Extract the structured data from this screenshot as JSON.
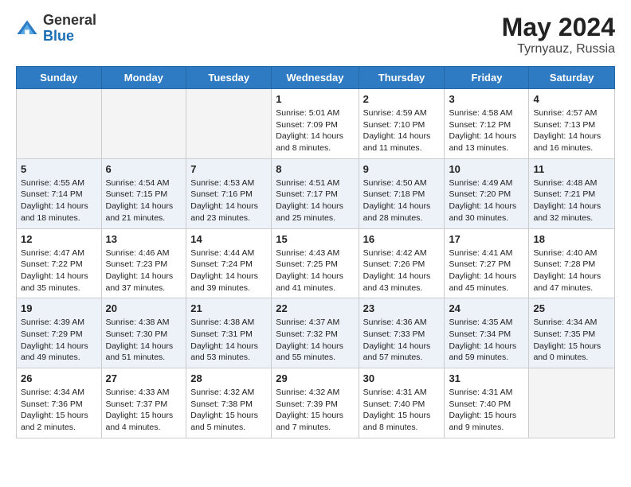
{
  "header": {
    "logo_general": "General",
    "logo_blue": "Blue",
    "title": "May 2024",
    "location": "Tyrnyauz, Russia"
  },
  "weekdays": [
    "Sunday",
    "Monday",
    "Tuesday",
    "Wednesday",
    "Thursday",
    "Friday",
    "Saturday"
  ],
  "weeks": [
    [
      {
        "day": "",
        "info": ""
      },
      {
        "day": "",
        "info": ""
      },
      {
        "day": "",
        "info": ""
      },
      {
        "day": "1",
        "info": "Sunrise: 5:01 AM\nSunset: 7:09 PM\nDaylight: 14 hours\nand 8 minutes."
      },
      {
        "day": "2",
        "info": "Sunrise: 4:59 AM\nSunset: 7:10 PM\nDaylight: 14 hours\nand 11 minutes."
      },
      {
        "day": "3",
        "info": "Sunrise: 4:58 AM\nSunset: 7:12 PM\nDaylight: 14 hours\nand 13 minutes."
      },
      {
        "day": "4",
        "info": "Sunrise: 4:57 AM\nSunset: 7:13 PM\nDaylight: 14 hours\nand 16 minutes."
      }
    ],
    [
      {
        "day": "5",
        "info": "Sunrise: 4:55 AM\nSunset: 7:14 PM\nDaylight: 14 hours\nand 18 minutes."
      },
      {
        "day": "6",
        "info": "Sunrise: 4:54 AM\nSunset: 7:15 PM\nDaylight: 14 hours\nand 21 minutes."
      },
      {
        "day": "7",
        "info": "Sunrise: 4:53 AM\nSunset: 7:16 PM\nDaylight: 14 hours\nand 23 minutes."
      },
      {
        "day": "8",
        "info": "Sunrise: 4:51 AM\nSunset: 7:17 PM\nDaylight: 14 hours\nand 25 minutes."
      },
      {
        "day": "9",
        "info": "Sunrise: 4:50 AM\nSunset: 7:18 PM\nDaylight: 14 hours\nand 28 minutes."
      },
      {
        "day": "10",
        "info": "Sunrise: 4:49 AM\nSunset: 7:20 PM\nDaylight: 14 hours\nand 30 minutes."
      },
      {
        "day": "11",
        "info": "Sunrise: 4:48 AM\nSunset: 7:21 PM\nDaylight: 14 hours\nand 32 minutes."
      }
    ],
    [
      {
        "day": "12",
        "info": "Sunrise: 4:47 AM\nSunset: 7:22 PM\nDaylight: 14 hours\nand 35 minutes."
      },
      {
        "day": "13",
        "info": "Sunrise: 4:46 AM\nSunset: 7:23 PM\nDaylight: 14 hours\nand 37 minutes."
      },
      {
        "day": "14",
        "info": "Sunrise: 4:44 AM\nSunset: 7:24 PM\nDaylight: 14 hours\nand 39 minutes."
      },
      {
        "day": "15",
        "info": "Sunrise: 4:43 AM\nSunset: 7:25 PM\nDaylight: 14 hours\nand 41 minutes."
      },
      {
        "day": "16",
        "info": "Sunrise: 4:42 AM\nSunset: 7:26 PM\nDaylight: 14 hours\nand 43 minutes."
      },
      {
        "day": "17",
        "info": "Sunrise: 4:41 AM\nSunset: 7:27 PM\nDaylight: 14 hours\nand 45 minutes."
      },
      {
        "day": "18",
        "info": "Sunrise: 4:40 AM\nSunset: 7:28 PM\nDaylight: 14 hours\nand 47 minutes."
      }
    ],
    [
      {
        "day": "19",
        "info": "Sunrise: 4:39 AM\nSunset: 7:29 PM\nDaylight: 14 hours\nand 49 minutes."
      },
      {
        "day": "20",
        "info": "Sunrise: 4:38 AM\nSunset: 7:30 PM\nDaylight: 14 hours\nand 51 minutes."
      },
      {
        "day": "21",
        "info": "Sunrise: 4:38 AM\nSunset: 7:31 PM\nDaylight: 14 hours\nand 53 minutes."
      },
      {
        "day": "22",
        "info": "Sunrise: 4:37 AM\nSunset: 7:32 PM\nDaylight: 14 hours\nand 55 minutes."
      },
      {
        "day": "23",
        "info": "Sunrise: 4:36 AM\nSunset: 7:33 PM\nDaylight: 14 hours\nand 57 minutes."
      },
      {
        "day": "24",
        "info": "Sunrise: 4:35 AM\nSunset: 7:34 PM\nDaylight: 14 hours\nand 59 minutes."
      },
      {
        "day": "25",
        "info": "Sunrise: 4:34 AM\nSunset: 7:35 PM\nDaylight: 15 hours\nand 0 minutes."
      }
    ],
    [
      {
        "day": "26",
        "info": "Sunrise: 4:34 AM\nSunset: 7:36 PM\nDaylight: 15 hours\nand 2 minutes."
      },
      {
        "day": "27",
        "info": "Sunrise: 4:33 AM\nSunset: 7:37 PM\nDaylight: 15 hours\nand 4 minutes."
      },
      {
        "day": "28",
        "info": "Sunrise: 4:32 AM\nSunset: 7:38 PM\nDaylight: 15 hours\nand 5 minutes."
      },
      {
        "day": "29",
        "info": "Sunrise: 4:32 AM\nSunset: 7:39 PM\nDaylight: 15 hours\nand 7 minutes."
      },
      {
        "day": "30",
        "info": "Sunrise: 4:31 AM\nSunset: 7:40 PM\nDaylight: 15 hours\nand 8 minutes."
      },
      {
        "day": "31",
        "info": "Sunrise: 4:31 AM\nSunset: 7:40 PM\nDaylight: 15 hours\nand 9 minutes."
      },
      {
        "day": "",
        "info": ""
      }
    ]
  ]
}
